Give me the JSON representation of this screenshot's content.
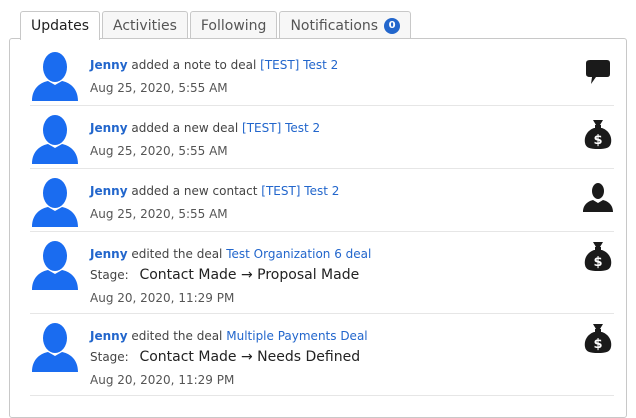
{
  "tabs": [
    {
      "label": "Updates",
      "active": true
    },
    {
      "label": "Activities",
      "active": false
    },
    {
      "label": "Following",
      "active": false
    },
    {
      "label": "Notifications",
      "active": false,
      "badge": "0"
    }
  ],
  "feed": [
    {
      "actor": "Jenny",
      "action": "added a note to deal",
      "target": "[TEST] Test 2",
      "timestamp": "Aug 25, 2020, 5:55 AM",
      "icon": "speech-bubble-icon"
    },
    {
      "actor": "Jenny",
      "action": "added a new deal",
      "target": "[TEST] Test 2",
      "timestamp": "Aug 25, 2020, 5:55 AM",
      "icon": "money-bag-icon"
    },
    {
      "actor": "Jenny",
      "action": "added a new contact",
      "target": "[TEST] Test 2",
      "timestamp": "Aug 25, 2020, 5:55 AM",
      "icon": "person-icon"
    },
    {
      "actor": "Jenny",
      "action": "edited the deal",
      "target": "Test Organization 6 deal",
      "stage_label": "Stage:",
      "stage_change": "Contact Made → Proposal Made",
      "timestamp": "Aug 20, 2020, 11:29 PM",
      "icon": "money-bag-icon"
    },
    {
      "actor": "Jenny",
      "action": "edited the deal",
      "target": "Multiple Payments Deal",
      "stage_label": "Stage:",
      "stage_change": "Contact Made → Needs Defined",
      "timestamp": "Aug 20, 2020, 11:29 PM",
      "icon": "money-bag-icon"
    }
  ],
  "colors": {
    "accent": "#2266cc",
    "avatar": "#1a6cf0",
    "icon": "#1a1a1a"
  }
}
